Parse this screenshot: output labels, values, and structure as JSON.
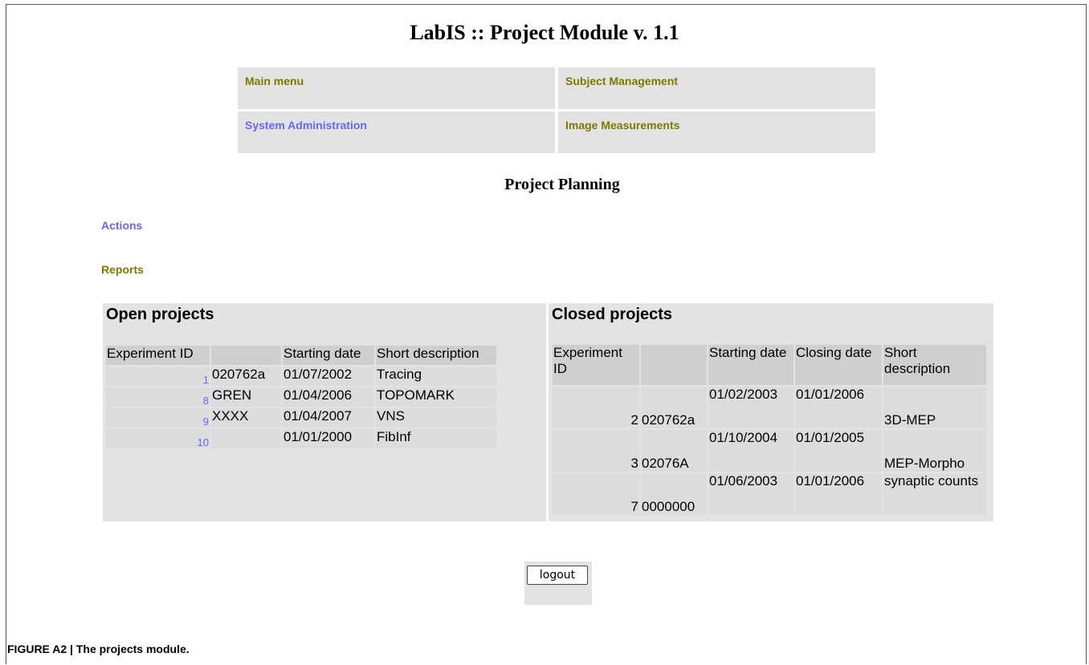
{
  "app": {
    "title": "LabIS :: Project Module v. 1.1"
  },
  "menu": {
    "main_menu": "Main menu",
    "subject_management": "Subject Management",
    "system_administration": "System Administration",
    "image_measurements": "Image Measurements"
  },
  "page": {
    "title": "Project Planning"
  },
  "links": {
    "actions": "Actions",
    "reports": "Reports"
  },
  "open_projects": {
    "title": "Open projects",
    "headers": [
      "Experiment ID",
      "",
      "Starting date",
      "Short description"
    ],
    "rows": [
      {
        "id": "1",
        "code": "020762a",
        "start": "01/07/2002",
        "desc": "Tracing"
      },
      {
        "id": "8",
        "code": "GREN",
        "start": "01/04/2006",
        "desc": "TOPOMARK"
      },
      {
        "id": "9",
        "code": "XXXX",
        "start": "01/04/2007",
        "desc": "VNS"
      },
      {
        "id": "10",
        "code": "",
        "start": "01/01/2000",
        "desc": "FibInf"
      }
    ]
  },
  "closed_projects": {
    "title": "Closed projects",
    "headers": [
      "Experiment ID",
      "",
      "Starting date",
      "Closing date",
      "Short description"
    ],
    "rows": [
      {
        "id": "2",
        "code": "020762a",
        "start": "01/02/2003",
        "close": "01/01/2006",
        "desc": "3D-MEP"
      },
      {
        "id": "3",
        "code": "02076A",
        "start": "01/10/2004",
        "close": "01/01/2005",
        "desc": "MEP-Morpho"
      },
      {
        "id": "7",
        "code": "0000000",
        "start": "01/06/2003",
        "close": "01/01/2006",
        "desc": "synaptic counts"
      }
    ]
  },
  "logout": {
    "label": "logout"
  },
  "caption": "FIGURE A2 | The projects module.",
  "colors": {
    "link_blue": "#6666ff",
    "link_olive": "#7d7900",
    "panel_gray": "#e3e3e3"
  }
}
